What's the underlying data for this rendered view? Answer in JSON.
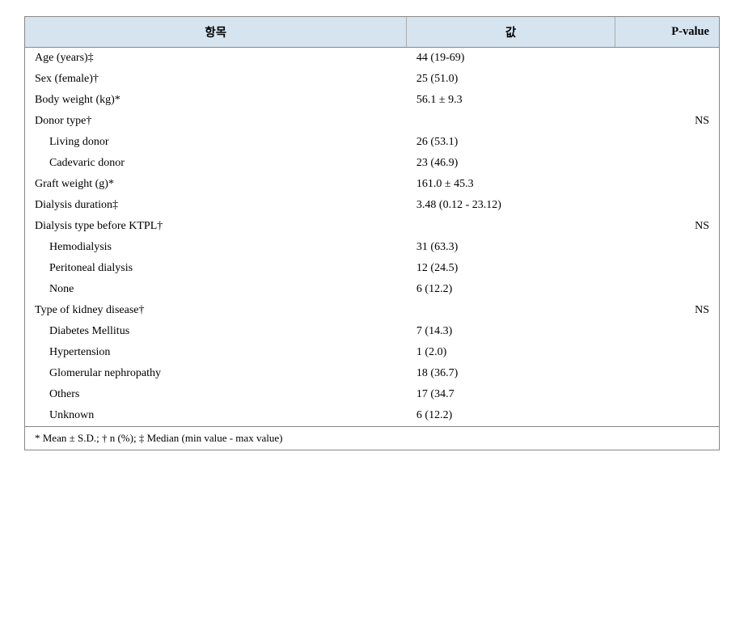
{
  "table": {
    "headers": {
      "item": "항목",
      "value": "값",
      "pvalue": "P-value"
    },
    "rows": [
      {
        "label": "Age (years)‡",
        "value": "44 (19-69)",
        "pvalue": "",
        "indent": false
      },
      {
        "label": "Sex (female)†",
        "value": "25 (51.0)",
        "pvalue": "",
        "indent": false
      },
      {
        "label": "Body weight (kg)*",
        "value": "56.1 ± 9.3",
        "pvalue": "",
        "indent": false
      },
      {
        "label": "Donor type†",
        "value": "",
        "pvalue": "NS",
        "indent": false
      },
      {
        "label": "Living donor",
        "value": "26 (53.1)",
        "pvalue": "",
        "indent": true
      },
      {
        "label": "Cadevaric donor",
        "value": "23 (46.9)",
        "pvalue": "",
        "indent": true
      },
      {
        "label": "Graft weight (g)*",
        "value": "161.0 ± 45.3",
        "pvalue": "",
        "indent": false
      },
      {
        "label": "Dialysis duration‡",
        "value": "3.48 (0.12 -   23.12)",
        "pvalue": "",
        "indent": false
      },
      {
        "label": "Dialysis type before KTPL†",
        "value": "",
        "pvalue": "NS",
        "indent": false
      },
      {
        "label": "Hemodialysis",
        "value": "31 (63.3)",
        "pvalue": "",
        "indent": true
      },
      {
        "label": "Peritoneal dialysis",
        "value": "12 (24.5)",
        "pvalue": "",
        "indent": true
      },
      {
        "label": "None",
        "value": "6 (12.2)",
        "pvalue": "",
        "indent": true
      },
      {
        "label": "Type of kidney disease†",
        "value": "",
        "pvalue": "NS",
        "indent": false
      },
      {
        "label": "Diabetes Mellitus",
        "value": "7 (14.3)",
        "pvalue": "",
        "indent": true
      },
      {
        "label": "Hypertension",
        "value": "1 (2.0)",
        "pvalue": "",
        "indent": true
      },
      {
        "label": "Glomerular nephropathy",
        "value": "18 (36.7)",
        "pvalue": "",
        "indent": true
      },
      {
        "label": "Others",
        "value": "17 (34.7",
        "pvalue": "",
        "indent": true
      },
      {
        "label": "Unknown",
        "value": "6 (12.2)",
        "pvalue": "",
        "indent": true
      }
    ],
    "footnote": "* Mean ± S.D.; † n (%); ‡ Median (min value -   max value)"
  }
}
